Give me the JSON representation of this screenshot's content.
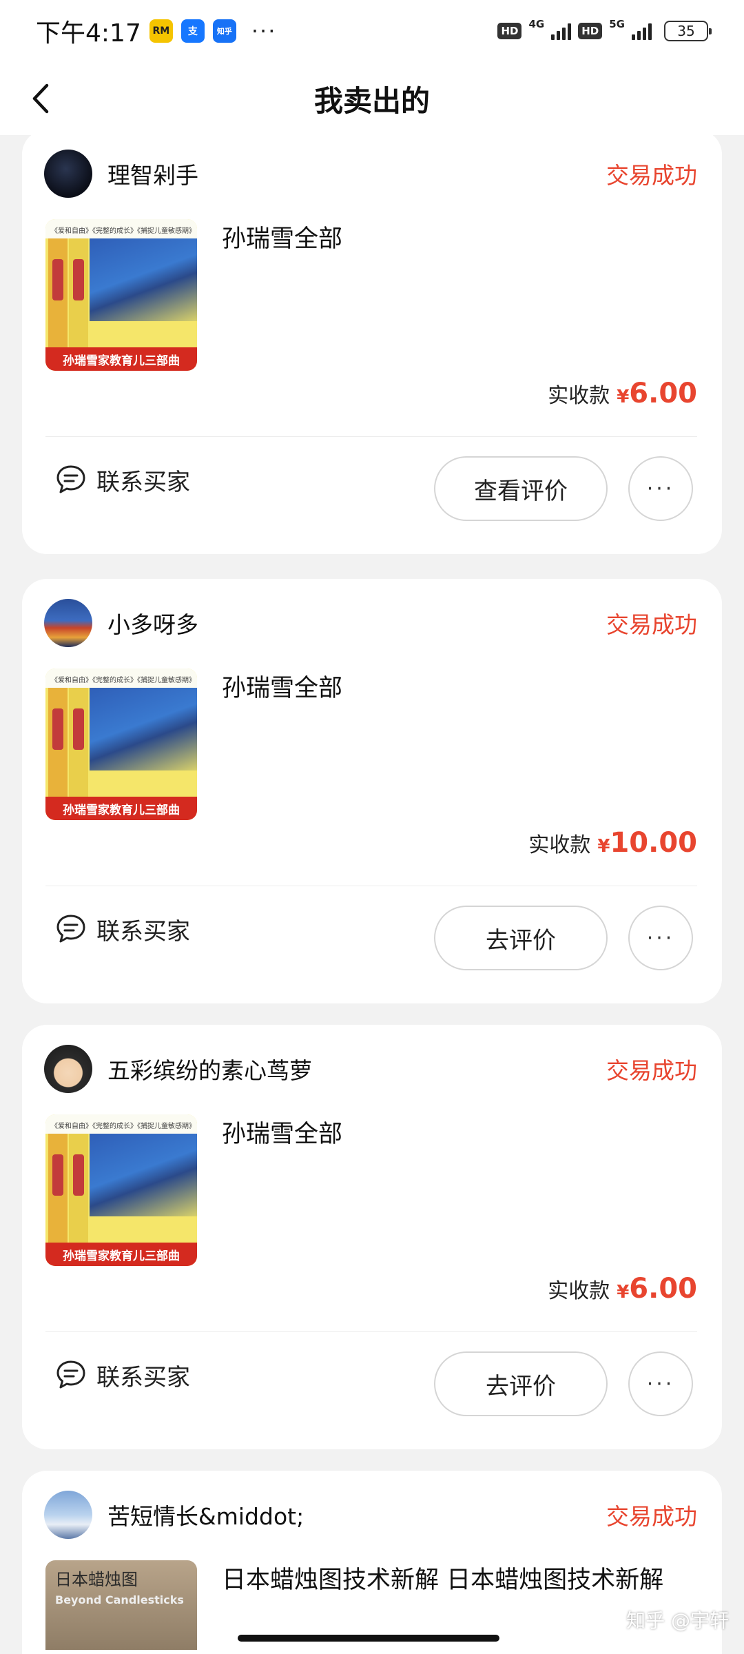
{
  "status_bar": {
    "time": "下午4:17",
    "app_icons": [
      {
        "name": "rinmi-app-icon",
        "text": "RM",
        "color": "#f5c400"
      },
      {
        "name": "alipay-icon",
        "text": "支",
        "color": "#1677ff"
      },
      {
        "name": "zhihu-app-icon",
        "text": "知乎",
        "color": "#1772f6"
      }
    ],
    "more": "···",
    "hd1": "HD",
    "net1": "4G",
    "hd2": "HD",
    "net2": "5G",
    "battery": "35"
  },
  "header": {
    "title": "我卖出的",
    "back_icon": "chevron-left-icon"
  },
  "colors": {
    "accent_red": "#e8452f",
    "card_bg": "#ffffff",
    "page_bg": "#f2f2f2"
  },
  "orders": [
    {
      "buyer": "理智剁手",
      "status": "交易成功",
      "item_title": "孙瑞雪全部",
      "price_label": "实收款",
      "currency": "¥",
      "price": "6.00",
      "contact_label": "联系买家",
      "action_label": "查看评价",
      "more_label": "···",
      "cover": {
        "strip": "《爱和自由》《完整的成长》《捕捉儿童敏感期》",
        "banner": "孙瑞雪家教育儿三部曲"
      }
    },
    {
      "buyer": "小多呀多",
      "status": "交易成功",
      "item_title": "孙瑞雪全部",
      "price_label": "实收款",
      "currency": "¥",
      "price": "10.00",
      "contact_label": "联系买家",
      "action_label": "去评价",
      "more_label": "···",
      "cover": {
        "strip": "《爱和自由》《完整的成长》《捕捉儿童敏感期》",
        "banner": "孙瑞雪家教育儿三部曲"
      }
    },
    {
      "buyer": "五彩缤纷的素心茑萝",
      "status": "交易成功",
      "item_title": "孙瑞雪全部",
      "price_label": "实收款",
      "currency": "¥",
      "price": "6.00",
      "contact_label": "联系买家",
      "action_label": "去评价",
      "more_label": "···",
      "cover": {
        "strip": "《爱和自由》《完整的成长》《捕捉儿童敏感期》",
        "banner": "孙瑞雪家教育儿三部曲"
      }
    },
    {
      "buyer": "苦短情长&middot;",
      "status": "交易成功",
      "item_title": "日本蜡烛图技术新解 日本蜡烛图技术新解",
      "cover": {
        "title": "日本蜡烛图",
        "subtitle": "Beyond Candlesticks"
      }
    }
  ],
  "watermark": "知乎 @宇轩"
}
